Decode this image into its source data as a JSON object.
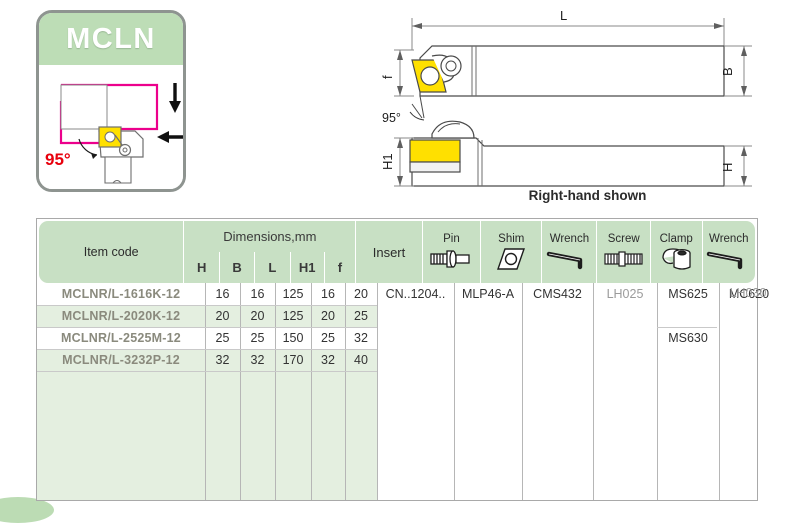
{
  "badge": {
    "title": "MCLN",
    "angle_label": "95°",
    "angle_color": "#e8000d",
    "insert_color": "#ffe000",
    "workpiece_color": "#ec008c"
  },
  "drawing": {
    "caption": "Right-hand shown",
    "dimension_labels": {
      "length": "L",
      "width": "B",
      "front": "f",
      "height_total": "H1",
      "height": "H"
    },
    "angle_label": "95°"
  },
  "table": {
    "headers": {
      "item_code": "Item code",
      "dimensions": "Dimensions,mm",
      "dimension_subs": [
        "H",
        "B",
        "L",
        "H1",
        "f"
      ],
      "insert": "Insert",
      "pin": "Pin",
      "shim": "Shim",
      "wrench1": "Wrench",
      "screw": "Screw",
      "clamp": "Clamp",
      "wrench2": "Wrench"
    },
    "icons": {
      "pin": "pin-icon",
      "shim": "shim-icon",
      "wrench1": "allen-wrench-icon",
      "screw": "screw-icon",
      "clamp": "clamp-icon",
      "wrench2": "allen-wrench-icon"
    },
    "rows": [
      {
        "code": "MCLNR/L-1616K-12",
        "H": "16",
        "B": "16",
        "L": "125",
        "H1": "16",
        "f": "20"
      },
      {
        "code": "MCLNR/L-2020K-12",
        "H": "20",
        "B": "20",
        "L": "125",
        "H1": "20",
        "f": "25"
      },
      {
        "code": "MCLNR/L-2525M-12",
        "H": "25",
        "B": "25",
        "L": "150",
        "H1": "25",
        "f": "32"
      },
      {
        "code": "MCLNR/L-3232P-12",
        "H": "32",
        "B": "32",
        "L": "170",
        "H1": "32",
        "f": "40"
      }
    ],
    "accessories": {
      "insert": "CN..1204..",
      "pin": "MLP46-A",
      "shim": "CMS432",
      "wrench1": "LH025",
      "screw_top": "MS625",
      "screw_bottom": "MS630",
      "clamp": "MC620",
      "wrench2": "LH030"
    },
    "colors": {
      "header_green": "#c8e0c4",
      "row_green": "#e4efe0",
      "border": "#a9a9a9",
      "code_text": "#8a8a7d"
    }
  }
}
